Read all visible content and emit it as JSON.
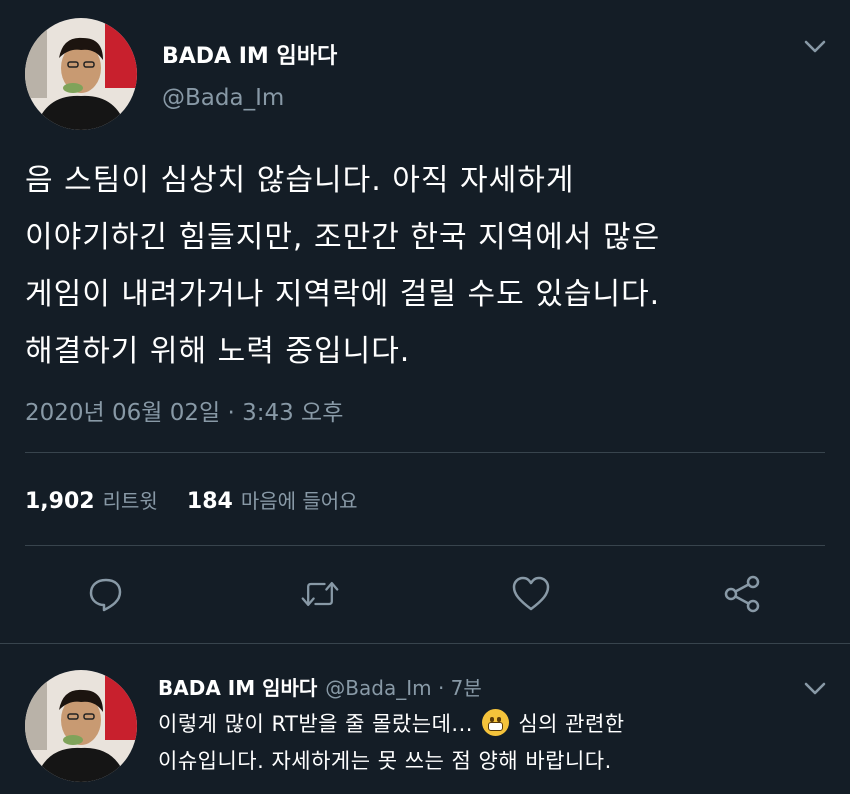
{
  "tweet": {
    "author_name": "BADA IM 임바다",
    "author_handle": "@Bada_Im",
    "text_lines": [
      "음 스팀이 심상치 않습니다. 아직 자세하게",
      "이야기하긴 힘들지만, 조만간 한국 지역에서 많은",
      "게임이 내려가거나 지역락에 걸릴 수도 있습니다.",
      "해결하기 위해 노력 중입니다."
    ],
    "timestamp": "2020년 06월 02일 · 3:43 오후",
    "retweet_count": "1,902",
    "retweet_label": "리트윗",
    "like_count": "184",
    "like_label": "마음에 들어요"
  },
  "reply": {
    "author_name": "BADA IM 임바다",
    "meta": "@Bada_Im · 7분",
    "text_line1_before": "이렇게 많이 RT받을 줄 몰랐는데...",
    "text_line1_after": "심의 관련한",
    "text_line2": "이슈입니다. 자세하게는 못 쓰는 점 양해 바랍니다."
  },
  "icons": {
    "chevron": "chevron-down-icon",
    "reply": "reply-icon",
    "retweet": "retweet-icon",
    "like": "heart-icon",
    "share": "share-icon",
    "emoji": "grimacing-face-emoji"
  },
  "colors": {
    "background": "#141d26",
    "secondary_text": "#8899a6",
    "divider": "#38444d"
  }
}
